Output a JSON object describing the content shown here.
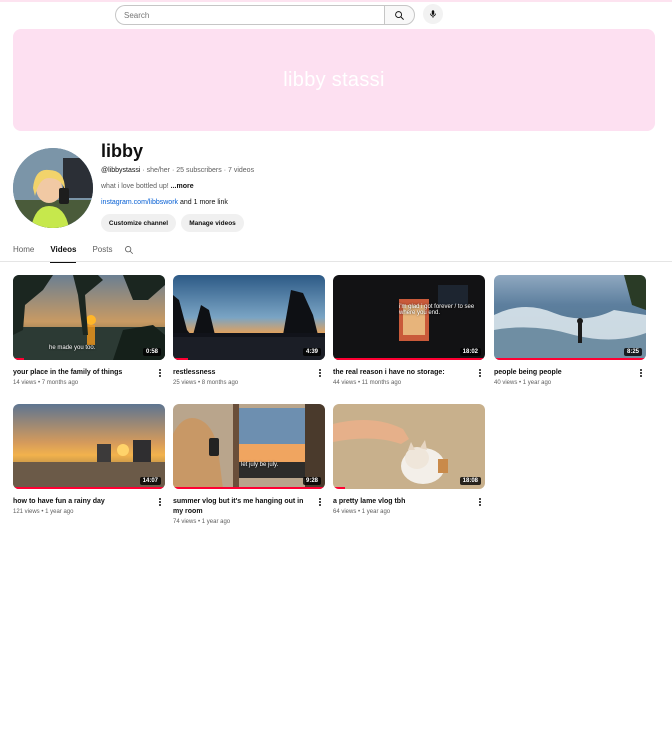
{
  "search": {
    "placeholder": "Search"
  },
  "banner": {
    "text": "libby stassi"
  },
  "channel": {
    "name": "libby",
    "handle": "@libbystassi",
    "pronouns": "she/her",
    "subscribers": "25 subscribers",
    "videos_count": "7 videos",
    "description": "what i love bottled up!",
    "more": "...more",
    "link": "instagram.com/libbswork",
    "more_links": "and 1 more link",
    "customize_label": "Customize channel",
    "manage_label": "Manage videos"
  },
  "tabs": [
    {
      "label": "Home"
    },
    {
      "label": "Videos",
      "active": true
    },
    {
      "label": "Posts"
    }
  ],
  "videos": [
    {
      "title": "your place in the family of things",
      "views": "14 views",
      "age": "7 months ago",
      "duration": "0:58",
      "overlay": "he made you too.",
      "watched_fraction": 0.07
    },
    {
      "title": "restlessness",
      "views": "25 views",
      "age": "8 months ago",
      "duration": "4:39",
      "overlay": "",
      "watched_fraction": 0.1
    },
    {
      "title": "the real reason i have no storage:",
      "views": "44 views",
      "age": "11 months ago",
      "duration": "18:02",
      "overlay": "i'm glad i got forever / to see where you end.",
      "watched_fraction": 1.0
    },
    {
      "title": "people being people",
      "views": "40 views",
      "age": "1 year ago",
      "duration": "8:25",
      "overlay": "",
      "watched_fraction": 1.0
    },
    {
      "title": "how to have fun a rainy day",
      "views": "121 views",
      "age": "1 year ago",
      "duration": "14:07",
      "overlay": "",
      "watched_fraction": 1.0
    },
    {
      "title": "summer vlog but it's me hanging out in my room",
      "views": "74 views",
      "age": "1 year ago",
      "duration": "9:28",
      "overlay": "let july be july.",
      "watched_fraction": 1.0
    },
    {
      "title": "a pretty lame vlog tbh",
      "views": "64 views",
      "age": "1 year ago",
      "duration": "18:08",
      "overlay": "",
      "watched_fraction": 0.08
    }
  ],
  "colors": {
    "banner": "#fde0f1",
    "progress": "#ff0033",
    "link": "#065fd4"
  },
  "icons": {
    "search": "search-icon",
    "mic": "microphone-icon",
    "more": "more-vert-icon"
  }
}
